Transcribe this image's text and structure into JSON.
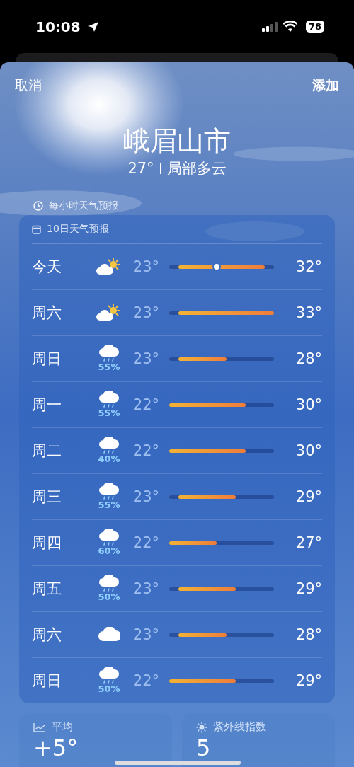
{
  "status_bar": {
    "time": "10:08",
    "battery": "78"
  },
  "nav": {
    "cancel": "取消",
    "add": "添加"
  },
  "location": {
    "city": "峨眉山市",
    "current_temp": "27°",
    "condition": "局部多云"
  },
  "hourly": {
    "title": "每小时天气预报"
  },
  "forecast": {
    "title": "10日天气预报",
    "days": [
      {
        "day": "今天",
        "kind": "partly_sunny",
        "low": "23°",
        "high": "32°",
        "current": true
      },
      {
        "day": "周六",
        "kind": "partly_sunny",
        "low": "23°",
        "high": "33°",
        "current": false
      },
      {
        "day": "周日",
        "kind": "rain",
        "precip": "55%",
        "low": "23°",
        "high": "28°",
        "current": false
      },
      {
        "day": "周一",
        "kind": "rain",
        "precip": "55%",
        "low": "22°",
        "high": "30°",
        "current": false
      },
      {
        "day": "周二",
        "kind": "rain",
        "precip": "40%",
        "low": "22°",
        "high": "30°",
        "current": false
      },
      {
        "day": "周三",
        "kind": "rain",
        "precip": "55%",
        "low": "23°",
        "high": "29°",
        "current": false
      },
      {
        "day": "周四",
        "kind": "rain",
        "precip": "60%",
        "low": "22°",
        "high": "27°",
        "current": false
      },
      {
        "day": "周五",
        "kind": "rain",
        "precip": "50%",
        "low": "23°",
        "high": "29°",
        "current": false
      },
      {
        "day": "周六",
        "kind": "cloudy",
        "low": "23°",
        "high": "28°",
        "current": false
      },
      {
        "day": "周日",
        "kind": "rain",
        "precip": "50%",
        "low": "22°",
        "high": "29°",
        "current": false
      }
    ]
  },
  "tiles": [
    {
      "kind": "average",
      "title": "平均",
      "value": "+5°"
    },
    {
      "kind": "uv",
      "title": "紫外线指数",
      "value": "5"
    }
  ]
}
